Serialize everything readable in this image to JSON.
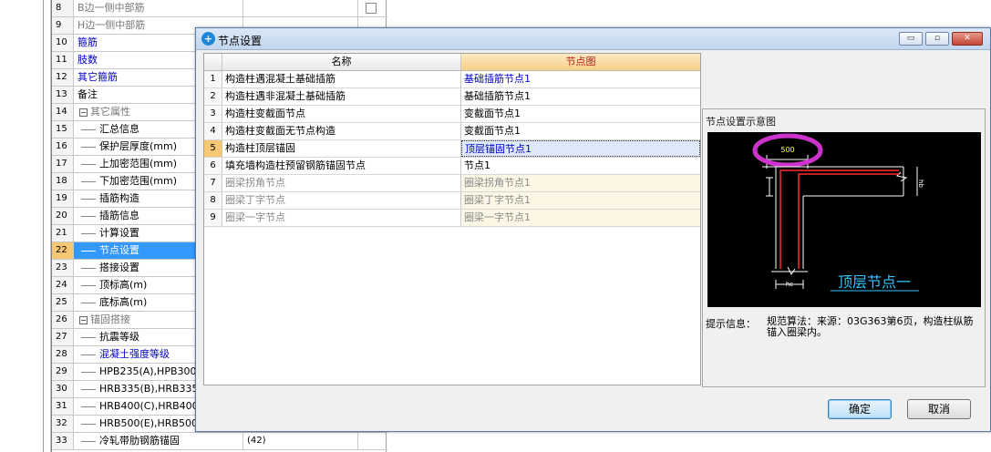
{
  "bg_grid": {
    "rows": [
      {
        "num": "8",
        "name": "B边一侧中部筋",
        "style": "gray",
        "value": "",
        "check": true
      },
      {
        "num": "9",
        "name": "H边一侧中部筋",
        "style": "gray",
        "value": "",
        "check": false
      },
      {
        "num": "10",
        "name": "箍筋",
        "style": "blue",
        "value": "",
        "check": false
      },
      {
        "num": "11",
        "name": "肢数",
        "style": "blue",
        "value": "",
        "check": false
      },
      {
        "num": "12",
        "name": "其它箍筋",
        "style": "blue",
        "value": "",
        "check": false
      },
      {
        "num": "13",
        "name": "备注",
        "style": "",
        "value": "",
        "check": false
      },
      {
        "num": "14",
        "name": "其它属性",
        "style": "gray",
        "value": "",
        "check": false,
        "box": "−"
      },
      {
        "num": "15",
        "name": "汇总信息",
        "style": "",
        "value": "",
        "check": false,
        "tree": true
      },
      {
        "num": "16",
        "name": "保护层厚度(mm)",
        "style": "",
        "value": "",
        "check": false,
        "tree": true
      },
      {
        "num": "17",
        "name": "上加密范围(mm)",
        "style": "",
        "value": "",
        "check": false,
        "tree": true
      },
      {
        "num": "18",
        "name": "下加密范围(mm)",
        "style": "",
        "value": "",
        "check": false,
        "tree": true
      },
      {
        "num": "19",
        "name": "插筋构造",
        "style": "",
        "value": "",
        "check": false,
        "tree": true
      },
      {
        "num": "20",
        "name": "插筋信息",
        "style": "",
        "value": "",
        "check": false,
        "tree": true
      },
      {
        "num": "21",
        "name": "计算设置",
        "style": "",
        "value": "",
        "check": false,
        "tree": true
      },
      {
        "num": "22",
        "name": "节点设置",
        "style": "",
        "value": "",
        "check": false,
        "tree": true,
        "selected": true
      },
      {
        "num": "23",
        "name": "搭接设置",
        "style": "",
        "value": "",
        "check": false,
        "tree": true
      },
      {
        "num": "24",
        "name": "顶标高(m)",
        "style": "",
        "value": "",
        "check": false,
        "tree": true
      },
      {
        "num": "25",
        "name": "底标高(m)",
        "style": "",
        "value": "",
        "check": false,
        "tree": true
      },
      {
        "num": "26",
        "name": "锚固搭接",
        "style": "gray",
        "value": "",
        "check": false,
        "box": "−"
      },
      {
        "num": "27",
        "name": "抗震等级",
        "style": "",
        "value": "",
        "check": false,
        "tree": true
      },
      {
        "num": "28",
        "name": "混凝土强度等级",
        "style": "blue",
        "value": "",
        "check": false,
        "tree": true
      },
      {
        "num": "29",
        "name": "HPB235(A),HPB300(A)",
        "style": "",
        "value": "",
        "check": false,
        "tree": true
      },
      {
        "num": "30",
        "name": "HRB335(B),HRB335E(",
        "style": "",
        "value": "",
        "check": false,
        "tree": true
      },
      {
        "num": "31",
        "name": "HRB400(C),HRB400E(",
        "style": "",
        "value": "",
        "check": false,
        "tree": true
      },
      {
        "num": "32",
        "name": "HRB500(E),HRB500E(",
        "style": "",
        "value": "",
        "check": false,
        "tree": true
      },
      {
        "num": "33",
        "name": "冷轧带肋钢筋锚固",
        "style": "",
        "value": "(42)",
        "check": false,
        "tree": true
      }
    ]
  },
  "dialog": {
    "title": "节点设置",
    "title_icon": "+",
    "min_label": "▭",
    "max_label": "▫",
    "close_label": "✕",
    "table": {
      "col_name": "名称",
      "col_picture": "节点图",
      "rows": [
        {
          "num": "1",
          "name": "构造柱遇混凝土基础插筋",
          "picture": "基础插筋节点1",
          "state": "link"
        },
        {
          "num": "2",
          "name": "构造柱遇非混凝土基础插筋",
          "picture": "基础插筋节点1",
          "state": ""
        },
        {
          "num": "3",
          "name": "构造柱变截面节点",
          "picture": "变截面节点1",
          "state": ""
        },
        {
          "num": "4",
          "name": "构造柱变截面无节点构造",
          "picture": "变截面节点1",
          "state": ""
        },
        {
          "num": "5",
          "name": "构造柱顶层锚固",
          "picture": "顶层锚固节点1",
          "state": "selected"
        },
        {
          "num": "6",
          "name": "填充墙构造柱预留钢筋锚固节点",
          "picture": "节点1",
          "state": ""
        },
        {
          "num": "7",
          "name": "圈梁拐角节点",
          "picture": "圈梁拐角节点1",
          "state": "disabled"
        },
        {
          "num": "8",
          "name": "圈梁丁字节点",
          "picture": "圈梁丁字节点1",
          "state": "disabled"
        },
        {
          "num": "9",
          "name": "圈梁一字节点",
          "picture": "圈梁一字节点1",
          "state": "disabled"
        }
      ]
    },
    "preview": {
      "label": "节点设置示意图",
      "dim_top": "500",
      "dim_right": "hb",
      "dim_bottom": "hc",
      "caption": "顶层节点一",
      "highlight_color": "#cc33cc",
      "caption_color": "#33c4ff"
    },
    "hint_label": "提示信息：",
    "hint_text": "规范算法：来源：03G363第6页，构造柱纵筋锚入圈梁内。",
    "ok_label": "确定",
    "cancel_label": "取消"
  }
}
